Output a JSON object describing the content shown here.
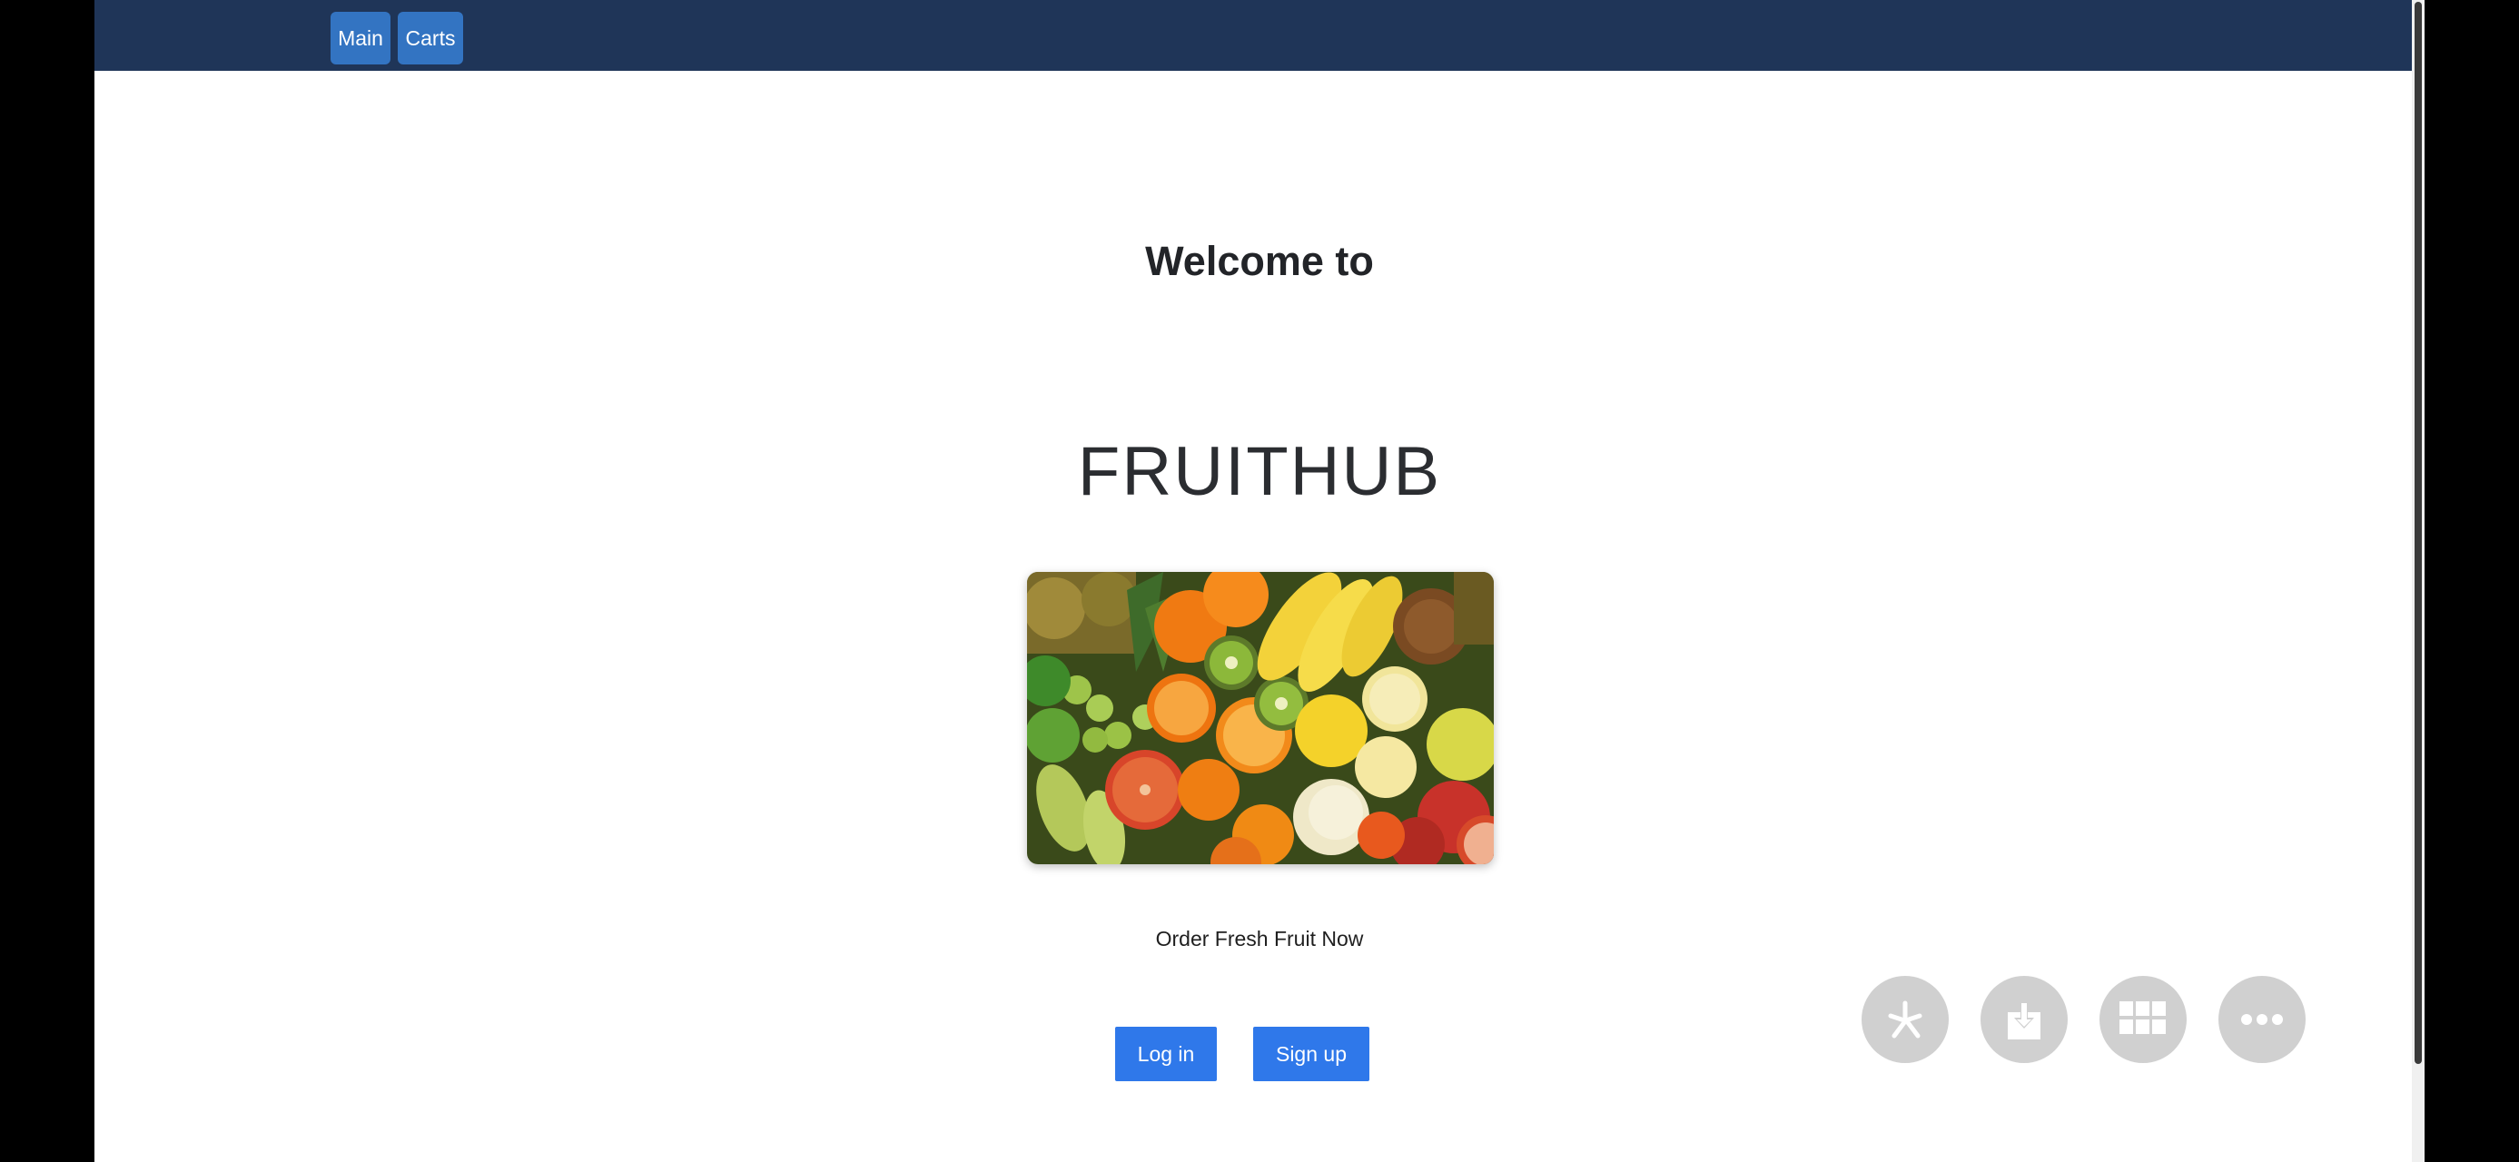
{
  "nav": {
    "main_label": "Main",
    "carts_label": "Carts"
  },
  "hero": {
    "welcome": "Welcome to",
    "brand": "FRUITHUB",
    "image_icon": "fruit-assortment-photo",
    "tagline": "Order Fresh Fruit Now"
  },
  "actions": {
    "login_label": "Log in",
    "signup_label": "Sign up"
  },
  "floating_buttons": [
    {
      "icon": "asterisk-icon"
    },
    {
      "icon": "download-icon"
    },
    {
      "icon": "grid-icon"
    },
    {
      "icon": "more-icon"
    }
  ],
  "colors": {
    "navbar": "#1f3558",
    "nav_button": "#3374c2",
    "primary_button": "#2f78ea",
    "fab": "#d0d0d0"
  }
}
